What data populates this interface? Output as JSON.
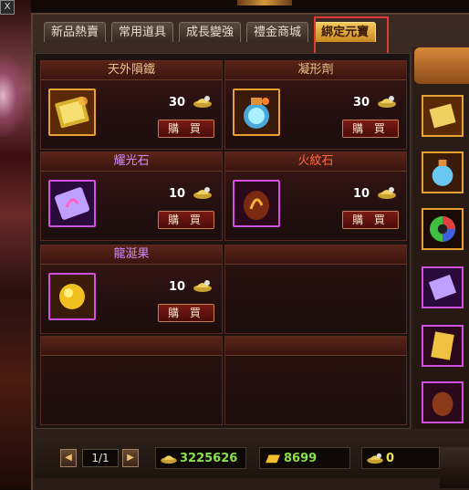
{
  "window": {
    "close_label": "X"
  },
  "tabs": [
    {
      "label": "新品熱賣",
      "active": false
    },
    {
      "label": "常用道具",
      "active": false
    },
    {
      "label": "成長變強",
      "active": false
    },
    {
      "label": "禮金商城",
      "active": false
    },
    {
      "label": "綁定元寶",
      "active": true
    }
  ],
  "items": [
    {
      "name": "天外隕鐵",
      "price": "30",
      "buy_label": "購 買",
      "name_color": "#e8c48a",
      "icon": "meteor-iron-book-icon"
    },
    {
      "name": "凝形劑",
      "price": "30",
      "buy_label": "購 買",
      "name_color": "#e8c48a",
      "icon": "potion-flask-icon"
    },
    {
      "name": "耀光石",
      "price": "10",
      "buy_label": "購 買",
      "name_color": "#d08cff",
      "icon": "glow-stone-icon"
    },
    {
      "name": "火紋石",
      "price": "10",
      "buy_label": "購 買",
      "name_color": "#ff6a48",
      "icon": "fire-rune-stone-icon"
    },
    {
      "name": "龍涎果",
      "price": "10",
      "buy_label": "購 買",
      "name_color": "#d08cff",
      "icon": "dragon-fruit-icon"
    }
  ],
  "side_items": [
    "meteor-iron-book-icon",
    "potion-flask-icon",
    "rainbow-orb-icon",
    "glow-stone-icon",
    "scroll-icon",
    "fire-rune-stone-icon"
  ],
  "pager": {
    "current": "1/1",
    "prev_icon": "arrow-left-icon",
    "next_icon": "arrow-right-icon"
  },
  "currency": {
    "yuanbao": "3225626",
    "bound_yuanbao": "8699",
    "gift_money": "0"
  },
  "colors": {
    "accent": "#f2c85a",
    "highlight_box": "#e23a36",
    "currency_green": "#8ae04a"
  }
}
